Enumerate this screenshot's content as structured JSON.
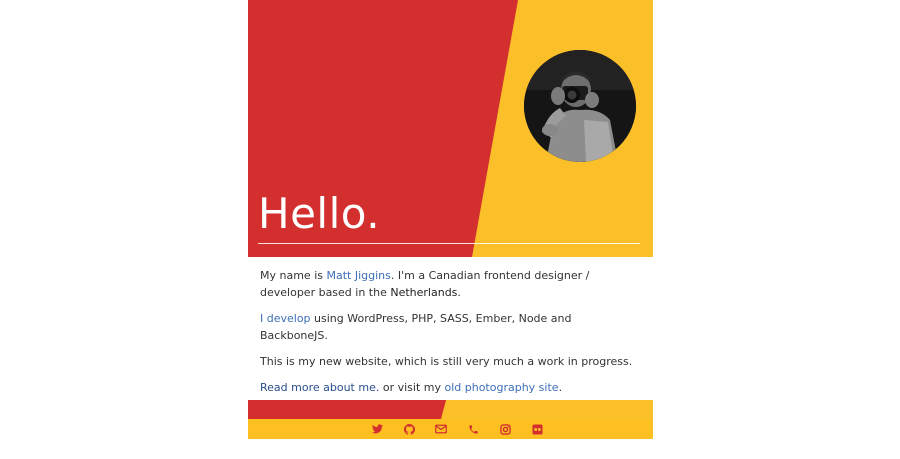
{
  "hero": {
    "title": "Hello.",
    "colors": {
      "red": "#d32f2f",
      "yellow": "#fbbf2a"
    }
  },
  "intro": {
    "p1_before": "My name is ",
    "name_link": "Matt Jiggins",
    "p1_after": ". I'm a Canadian frontend designer / developer based in the ",
    "location": "Netherlands",
    "p1_end": ".",
    "develop_link": "I develop",
    "p2_after": " using WordPress, PHP, SASS, Ember, Node and BackboneJS.",
    "p3": "This is my new website, which is still very much a work in progress.",
    "read_more_link": "Read more about me.",
    "p4_middle": " or visit my ",
    "photo_link": "old photography site",
    "p4_end": "."
  },
  "footer": {
    "icons": [
      "twitter-icon",
      "github-icon",
      "email-icon",
      "phone-icon",
      "instagram-icon",
      "flickr-icon"
    ],
    "icon_color": "#d32f2f",
    "bar_color": "#fec020"
  }
}
